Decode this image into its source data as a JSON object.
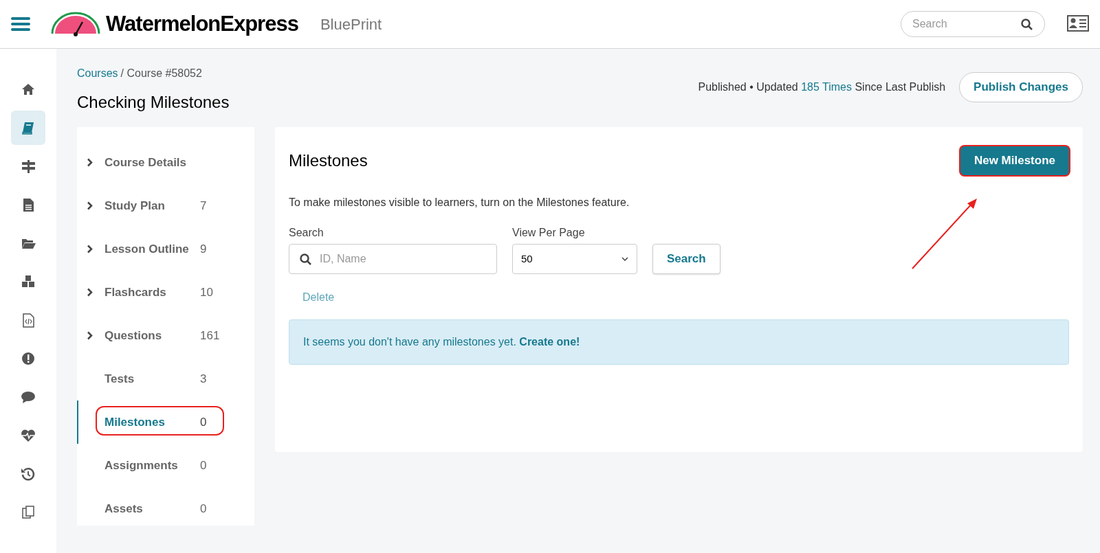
{
  "header": {
    "brand": "WatermelonExpress",
    "product": "BluePrint",
    "search": {
      "placeholder": "Search"
    }
  },
  "rail": [
    {
      "selected": false
    },
    {
      "selected": true
    },
    {
      "selected": false
    },
    {
      "selected": false
    },
    {
      "selected": false
    },
    {
      "selected": false
    },
    {
      "selected": false
    },
    {
      "selected": false
    },
    {
      "selected": false
    },
    {
      "selected": false
    },
    {
      "selected": false
    },
    {
      "selected": false
    }
  ],
  "breadcrumb": {
    "link": "Courses",
    "current": "/ Course #58052"
  },
  "page_title": "Checking Milestones",
  "publish": {
    "status_before": "Published • Updated ",
    "count_link": "185 Times",
    "status_after": " Since Last Publish",
    "button": "Publish Changes"
  },
  "nav": [
    {
      "label": "Course Details",
      "expandable": true,
      "selected": false,
      "highlighted": false
    },
    {
      "label": "Study Plan",
      "count": "7",
      "expandable": true,
      "selected": false,
      "highlighted": false
    },
    {
      "label": "Lesson Outline",
      "count": "9",
      "expandable": true,
      "selected": false,
      "highlighted": false
    },
    {
      "label": "Flashcards",
      "count": "10",
      "expandable": true,
      "selected": false,
      "highlighted": false
    },
    {
      "label": "Questions",
      "count": "161",
      "expandable": true,
      "selected": false,
      "highlighted": false
    },
    {
      "label": "Tests",
      "count": "3",
      "expandable": false,
      "selected": false,
      "highlighted": false
    },
    {
      "label": "Milestones",
      "count": "0",
      "expandable": false,
      "selected": true,
      "highlighted": true
    },
    {
      "label": "Assignments",
      "count": "0",
      "expandable": false,
      "selected": false,
      "highlighted": false
    },
    {
      "label": "Assets",
      "count": "0",
      "expandable": false,
      "selected": false,
      "highlighted": false
    }
  ],
  "main": {
    "title": "Milestones",
    "new_button": {
      "label": "New Milestone",
      "highlighted": true,
      "pointer_arrow": true
    },
    "hint": "To make milestones visible to learners, turn on the Milestones feature.",
    "search_label": "Search",
    "search_placeholder": "ID, Name",
    "per_page_label": "View Per Page",
    "per_page_value": "50",
    "search_button": "Search",
    "delete_button": "Delete",
    "empty_notice": "It seems you don't have any milestones yet. ",
    "empty_link": "Create one!"
  }
}
